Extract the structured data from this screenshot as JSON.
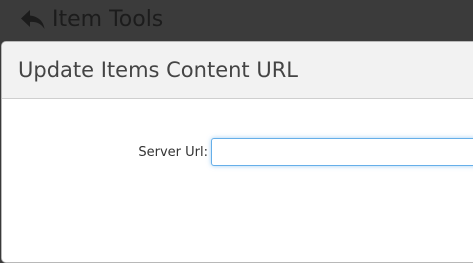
{
  "topbar": {
    "back_icon": "reply-arrow-icon",
    "title": "Item Tools"
  },
  "modal": {
    "title": "Update Items Content URL",
    "server_url": {
      "label": "Server Url:",
      "value": "",
      "placeholder": ""
    }
  },
  "colors": {
    "topbar_bg": "#3b3b3b",
    "modal_header_bg": "#f2f2f2",
    "input_focus_border": "#66afe9"
  }
}
